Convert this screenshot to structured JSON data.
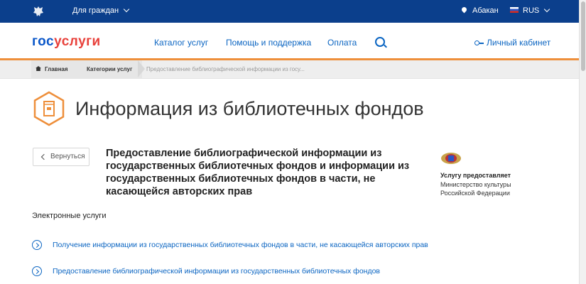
{
  "topbar": {
    "for_citizens": "Для граждан",
    "location": "Абакан",
    "language": "RUS"
  },
  "header": {
    "logo_part1": "гос",
    "logo_part2": "услуги",
    "nav": [
      "Каталог услуг",
      "Помощь и поддержка",
      "Оплата"
    ],
    "account": "Личный кабинет"
  },
  "breadcrumb": {
    "home": "Главная",
    "category": "Категории услуг",
    "current": "Предоставление библиографической информации из госу..."
  },
  "page": {
    "title": "Информация из библиотечных фондов",
    "back_label": "Вернуться",
    "service_title": "Предоставление библиографической информации из государственных библиотечных фондов и информации из государственных библиотечных фондов в части, не касающейся авторских прав"
  },
  "provider": {
    "label": "Услугу предоставляет",
    "name": "Министерство культуры Российской Федерации"
  },
  "services": {
    "section_title": "Электронные услуги",
    "items": [
      "Получение информации из государственных библиотечных фондов в части, не касающейся авторских прав",
      "Предоставление библиографической информации из государственных библиотечных фондов"
    ]
  },
  "colors": {
    "topbar_bg": "#0b3f8c",
    "accent_orange": "#ee8f3b",
    "link_blue": "#0b65c2",
    "logo_blue": "#0b57c9",
    "logo_red": "#e8403a"
  }
}
